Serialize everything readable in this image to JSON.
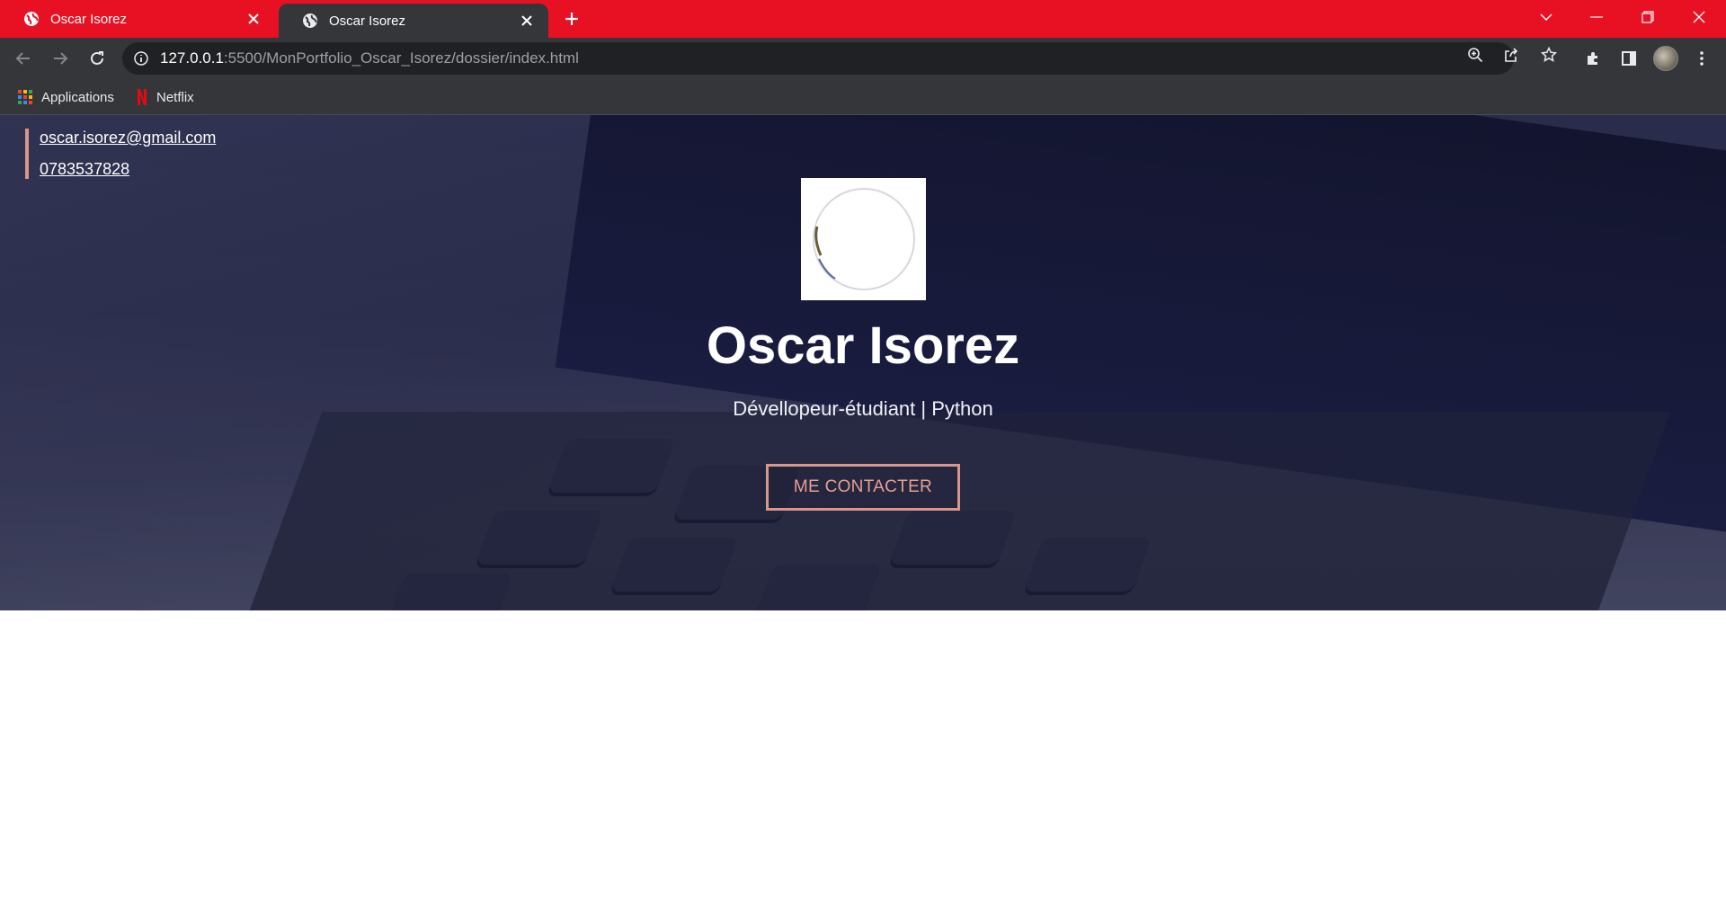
{
  "browser": {
    "tabs": [
      {
        "title": "Oscar Isorez",
        "active": false
      },
      {
        "title": "Oscar Isorez",
        "active": true
      }
    ],
    "url": {
      "host": "127.0.0.1",
      "path": ":5500/MonPortfolio_Oscar_Isorez/dossier/index.html"
    },
    "bookmarks": [
      {
        "label": "Applications",
        "icon": "apps-grid-icon"
      },
      {
        "label": "Netflix",
        "icon": "netflix-icon"
      }
    ],
    "colors": {
      "tab_strip": "#e81123",
      "toolbar": "#35363a",
      "omnibox": "#202124"
    }
  },
  "page": {
    "contact": {
      "email": "oscar.isorez@gmail.com",
      "phone": "0783537828"
    },
    "name": "Oscar Isorez",
    "subtitle": "Dévellopeur-étudiant | Python",
    "cta_label": "ME CONTACTER",
    "colors": {
      "accent": "#d9978b",
      "hero_text": "#ffffff"
    }
  }
}
